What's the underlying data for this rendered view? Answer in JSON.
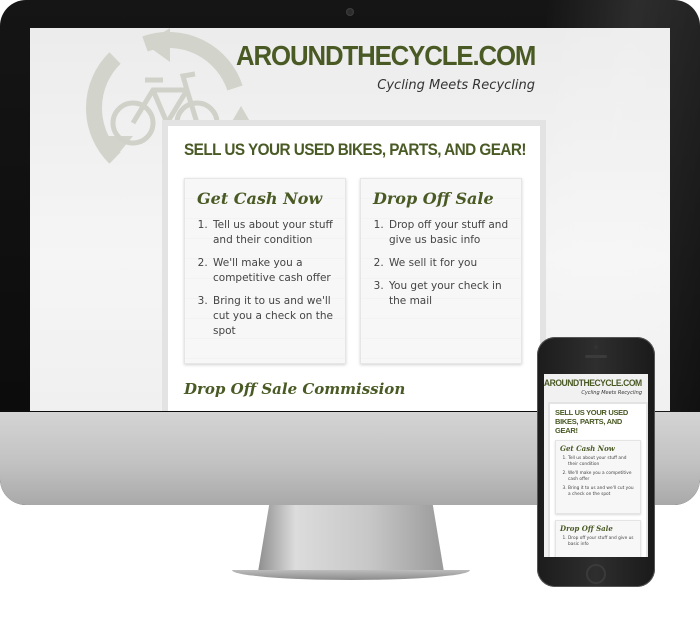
{
  "site": {
    "title": "AROUNDTHECYCLE.COM",
    "tagline": "Cycling Meets Recycling",
    "main_heading": "SELL US YOUR USED BIKES, PARTS, AND GEAR!",
    "panels": [
      {
        "title": "Get Cash Now",
        "items": [
          "Tell us about your stuff and their condition",
          "We'll make you a competitive cash offer",
          "Bring it to us and we'll cut you a check on the spot"
        ]
      },
      {
        "title": "Drop Off Sale",
        "items": [
          "Drop off your stuff and give us basic info",
          "We sell it for you",
          "You get your check in the mail"
        ]
      }
    ],
    "sub_heading": "Drop Off Sale Commission"
  },
  "mobile": {
    "title": "AROUNDTHECYCLE.COM",
    "tagline": "Cycling Meets Recycling",
    "heading": "SELL US YOUR USED BIKES, PARTS, AND GEAR!",
    "panels": [
      {
        "title": "Get Cash Now",
        "items": [
          "Tell us about your stuff and their condition",
          "We'll make you a competitive cash offer",
          "Bring it to us and we'll cut you a check on the spot"
        ]
      },
      {
        "title": "Drop Off Sale",
        "items": [
          "Drop off your stuff and give us basic info"
        ]
      }
    ]
  },
  "colors": {
    "brand_green": "#4a5a25",
    "device_black": "#111111",
    "device_silver": "#c8c8c8"
  },
  "icons": [
    "recycle-bicycle-logo-icon"
  ]
}
